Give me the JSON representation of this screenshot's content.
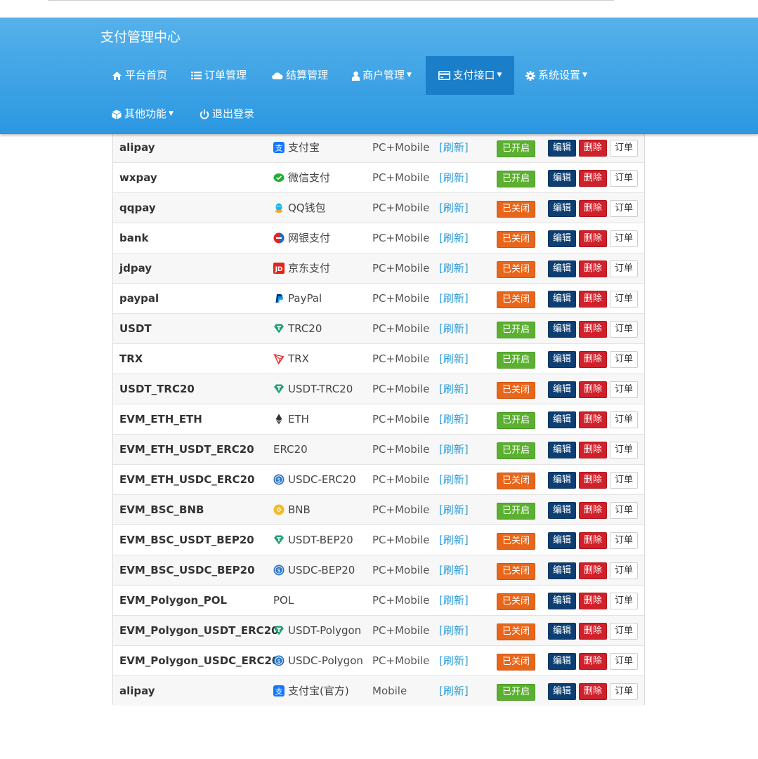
{
  "app": {
    "title": "支付管理中心"
  },
  "nav": {
    "home": "平台首页",
    "orders": "订单管理",
    "settlement": "结算管理",
    "merchants": "商户管理",
    "payment": "支付接口",
    "settings": "系统设置",
    "other": "其他功能",
    "logout": "退出登录"
  },
  "labels": {
    "refresh": "[刷新]",
    "edit": "编辑",
    "delete": "删除",
    "order": "订单",
    "enabled": "已开启",
    "disabled": "已关闭"
  },
  "colors": {
    "header_top": "#56b1ea",
    "header_bottom": "#2b97e1",
    "status_on": "#5cb031",
    "status_off": "#e8661a",
    "edit": "#0d3f73",
    "delete": "#d0202a",
    "link": "#2b9bd6"
  },
  "rows": [
    {
      "name": "alipay",
      "show": "支付宝",
      "icon": "alipay-icon",
      "device": "PC+Mobile",
      "enabled": true
    },
    {
      "name": "wxpay",
      "show": "微信支付",
      "icon": "wechat-pay-icon",
      "device": "PC+Mobile",
      "enabled": true
    },
    {
      "name": "qqpay",
      "show": "QQ钱包",
      "icon": "qq-wallet-icon",
      "device": "PC+Mobile",
      "enabled": false
    },
    {
      "name": "bank",
      "show": "网银支付",
      "icon": "bank-icon",
      "device": "PC+Mobile",
      "enabled": false
    },
    {
      "name": "jdpay",
      "show": "京东支付",
      "icon": "jd-icon",
      "device": "PC+Mobile",
      "enabled": false
    },
    {
      "name": "paypal",
      "show": "PayPal",
      "icon": "paypal-icon",
      "device": "PC+Mobile",
      "enabled": false
    },
    {
      "name": "USDT",
      "show": "TRC20",
      "icon": "tether-icon",
      "device": "PC+Mobile",
      "enabled": true
    },
    {
      "name": "TRX",
      "show": "TRX",
      "icon": "tron-icon",
      "device": "PC+Mobile",
      "enabled": true
    },
    {
      "name": "USDT_TRC20",
      "show": "USDT-TRC20",
      "icon": "tether-icon",
      "device": "PC+Mobile",
      "enabled": false
    },
    {
      "name": "EVM_ETH_ETH",
      "show": "ETH",
      "icon": "ethereum-icon",
      "device": "PC+Mobile",
      "enabled": true
    },
    {
      "name": "EVM_ETH_USDT_ERC20",
      "show": "ERC20",
      "icon": "",
      "device": "PC+Mobile",
      "enabled": true
    },
    {
      "name": "EVM_ETH_USDC_ERC20",
      "show": "USDC-ERC20",
      "icon": "usdc-icon",
      "device": "PC+Mobile",
      "enabled": false
    },
    {
      "name": "EVM_BSC_BNB",
      "show": "BNB",
      "icon": "bnb-icon",
      "device": "PC+Mobile",
      "enabled": true
    },
    {
      "name": "EVM_BSC_USDT_BEP20",
      "show": "USDT-BEP20",
      "icon": "tether-icon",
      "device": "PC+Mobile",
      "enabled": false
    },
    {
      "name": "EVM_BSC_USDC_BEP20",
      "show": "USDC-BEP20",
      "icon": "usdc-icon",
      "device": "PC+Mobile",
      "enabled": false
    },
    {
      "name": "EVM_Polygon_POL",
      "show": "POL",
      "icon": "",
      "device": "PC+Mobile",
      "enabled": false
    },
    {
      "name": "EVM_Polygon_USDT_ERC20",
      "show": "USDT-Polygon",
      "icon": "tether-icon",
      "device": "PC+Mobile",
      "enabled": false
    },
    {
      "name": "EVM_Polygon_USDC_ERC20",
      "show": "USDC-Polygon",
      "icon": "usdc-icon",
      "device": "PC+Mobile",
      "enabled": false
    },
    {
      "name": "alipay",
      "show": "支付宝(官方)",
      "icon": "alipay-icon",
      "device": "Mobile",
      "enabled": true
    }
  ]
}
